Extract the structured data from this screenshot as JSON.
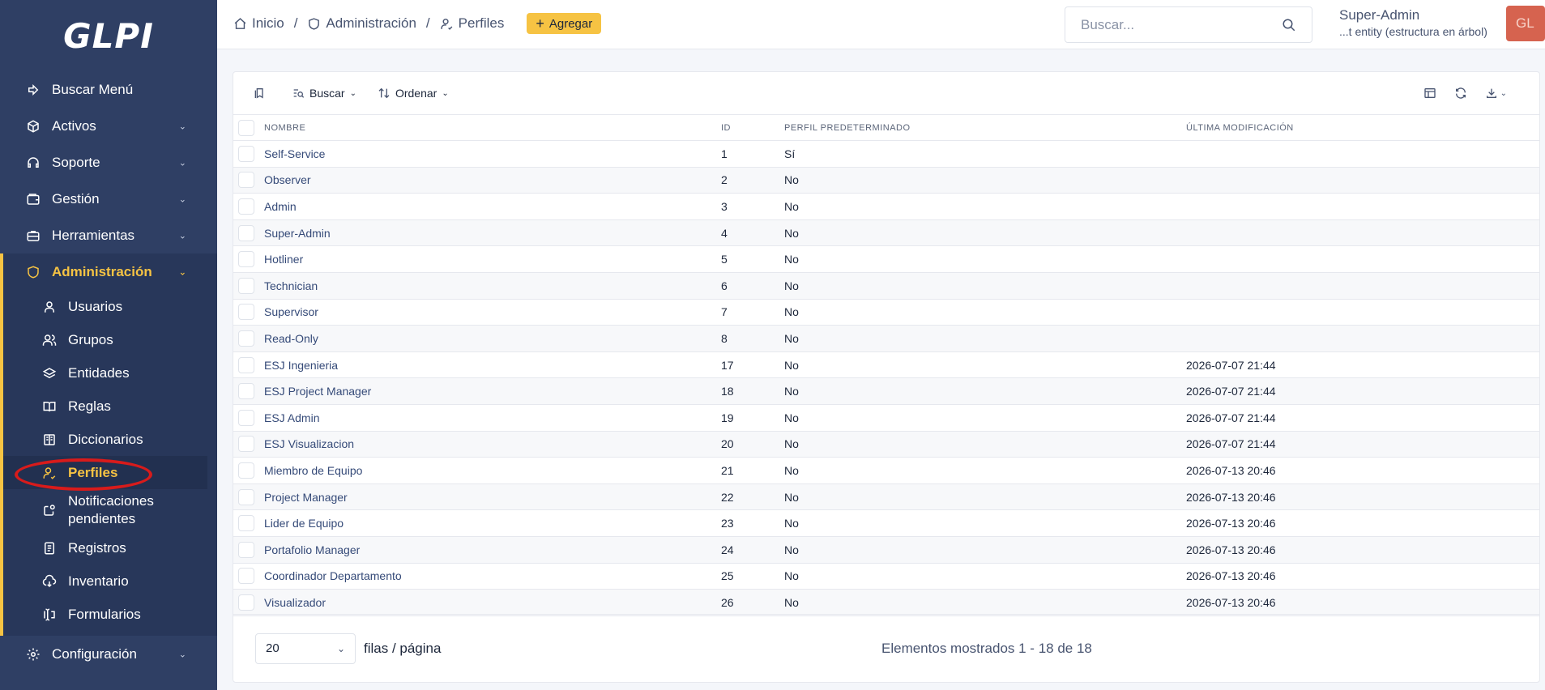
{
  "app": {
    "logo": "GLPI"
  },
  "sidebar": {
    "items": [
      {
        "label": "Buscar Menú",
        "icon": "arrow-right-icon",
        "chevron": false
      },
      {
        "label": "Activos",
        "icon": "cube-icon",
        "chevron": true
      },
      {
        "label": "Soporte",
        "icon": "headset-icon",
        "chevron": true
      },
      {
        "label": "Gestión",
        "icon": "wallet-icon",
        "chevron": true
      },
      {
        "label": "Herramientas",
        "icon": "briefcase-icon",
        "chevron": true
      },
      {
        "label": "Administración",
        "icon": "shield-icon",
        "chevron": true,
        "active": true
      },
      {
        "label": "Configuración",
        "icon": "gear-icon",
        "chevron": true
      }
    ],
    "admin_subitems": [
      {
        "label": "Usuarios",
        "icon": "user-icon"
      },
      {
        "label": "Grupos",
        "icon": "users-icon"
      },
      {
        "label": "Entidades",
        "icon": "stack-icon"
      },
      {
        "label": "Reglas",
        "icon": "book-icon"
      },
      {
        "label": "Diccionarios",
        "icon": "book-open-icon"
      },
      {
        "label": "Perfiles",
        "icon": "user-check-icon",
        "current": true
      },
      {
        "label": "Notificaciones pendientes",
        "icon": "notification-icon"
      },
      {
        "label": "Registros",
        "icon": "news-icon"
      },
      {
        "label": "Inventario",
        "icon": "cloud-download-icon"
      },
      {
        "label": "Formularios",
        "icon": "forms-icon"
      }
    ]
  },
  "header": {
    "breadcrumb": [
      "Inicio",
      "Administración",
      "Perfiles"
    ],
    "add_label": "Agregar",
    "search_placeholder": "Buscar...",
    "user_name": "Super-Admin",
    "user_entity": "...t entity (estructura en árbol)",
    "avatar_initials": "GL"
  },
  "toolbar": {
    "search_label": "Buscar",
    "sort_label": "Ordenar"
  },
  "table": {
    "columns": [
      "NOMBRE",
      "ID",
      "PERFIL PREDETERMINADO",
      "ÚLTIMA MODIFICACIÓN"
    ],
    "rows": [
      [
        "Self-Service",
        "1",
        "Sí",
        ""
      ],
      [
        "Observer",
        "2",
        "No",
        ""
      ],
      [
        "Admin",
        "3",
        "No",
        ""
      ],
      [
        "Super-Admin",
        "4",
        "No",
        ""
      ],
      [
        "Hotliner",
        "5",
        "No",
        ""
      ],
      [
        "Technician",
        "6",
        "No",
        ""
      ],
      [
        "Supervisor",
        "7",
        "No",
        ""
      ],
      [
        "Read-Only",
        "8",
        "No",
        ""
      ],
      [
        "ESJ Ingenieria",
        "17",
        "No",
        "2026-07-07 21:44"
      ],
      [
        "ESJ Project Manager",
        "18",
        "No",
        "2026-07-07 21:44"
      ],
      [
        "ESJ Admin",
        "19",
        "No",
        "2026-07-07 21:44"
      ],
      [
        "ESJ Visualizacion",
        "20",
        "No",
        "2026-07-07 21:44"
      ],
      [
        "Miembro de Equipo",
        "21",
        "No",
        "2026-07-13 20:46"
      ],
      [
        "Project Manager",
        "22",
        "No",
        "2026-07-13 20:46"
      ],
      [
        "Lider de Equipo",
        "23",
        "No",
        "2026-07-13 20:46"
      ],
      [
        "Portafolio Manager",
        "24",
        "No",
        "2026-07-13 20:46"
      ],
      [
        "Coordinador Departamento",
        "25",
        "No",
        "2026-07-13 20:46"
      ],
      [
        "Visualizador",
        "26",
        "No",
        "2026-07-13 20:46"
      ]
    ]
  },
  "footer": {
    "page_size": "20",
    "rows_label": "filas / página",
    "shown_text": "Elementos mostrados 1 - 18 de 18"
  },
  "colors": {
    "sidebar_bg": "#2f3f64",
    "accent": "#f6c343",
    "link": "#354a78",
    "avatar_bg": "#d6634f",
    "annotation": "#d81b1b"
  }
}
